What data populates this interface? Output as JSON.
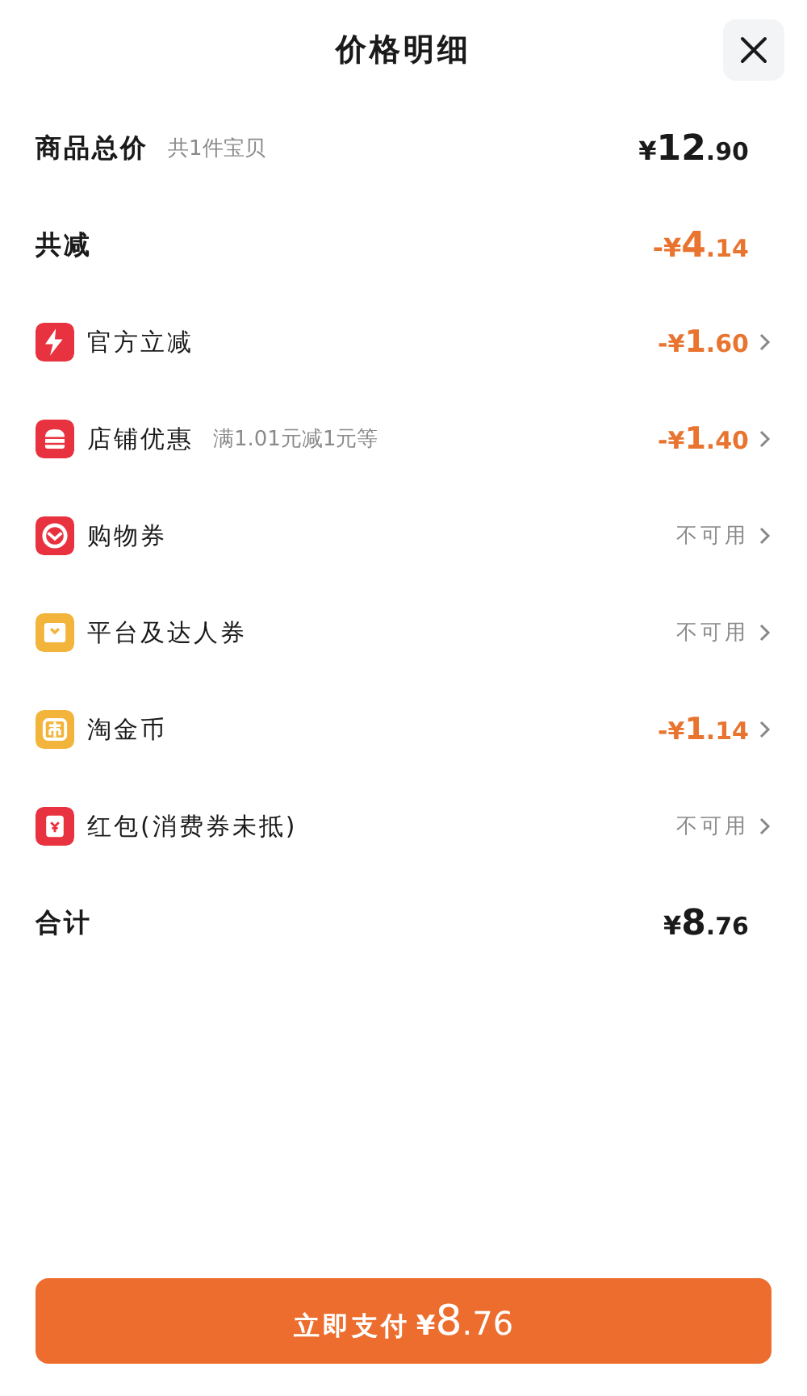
{
  "header": {
    "title": "价格明细"
  },
  "summary": [
    {
      "kind": "total",
      "label": "商品总价",
      "note": "共1件宝贝",
      "amount": "¥12.90"
    },
    {
      "kind": "reduction",
      "label": "共减",
      "amount": "-¥4.14"
    }
  ],
  "items": [
    {
      "color": "#e8323f",
      "label": "官方立减",
      "kind": "discount",
      "value": "-¥1.60"
    },
    {
      "color": "#e8323f",
      "label": "店铺优惠",
      "note": "满1.01元减1元等",
      "kind": "discount",
      "value": "-¥1.40"
    },
    {
      "color": "#e8323f",
      "label": "购物券",
      "kind": "unavailable",
      "value": "不可用"
    },
    {
      "color": "#f2b43a",
      "label": "平台及达人券",
      "kind": "unavailable",
      "value": "不可用"
    },
    {
      "color": "#f2b43a",
      "label": "淘金币",
      "kind": "discount",
      "value": "-¥1.14"
    },
    {
      "color": "#e8323f",
      "label": "红包(消费券未抵)",
      "kind": "unavailable",
      "value": "不可用"
    }
  ],
  "footer_total": {
    "label": "合计",
    "amount": "¥8.76"
  },
  "pay_button": {
    "label": "立即支付",
    "amount": "¥8.76"
  }
}
